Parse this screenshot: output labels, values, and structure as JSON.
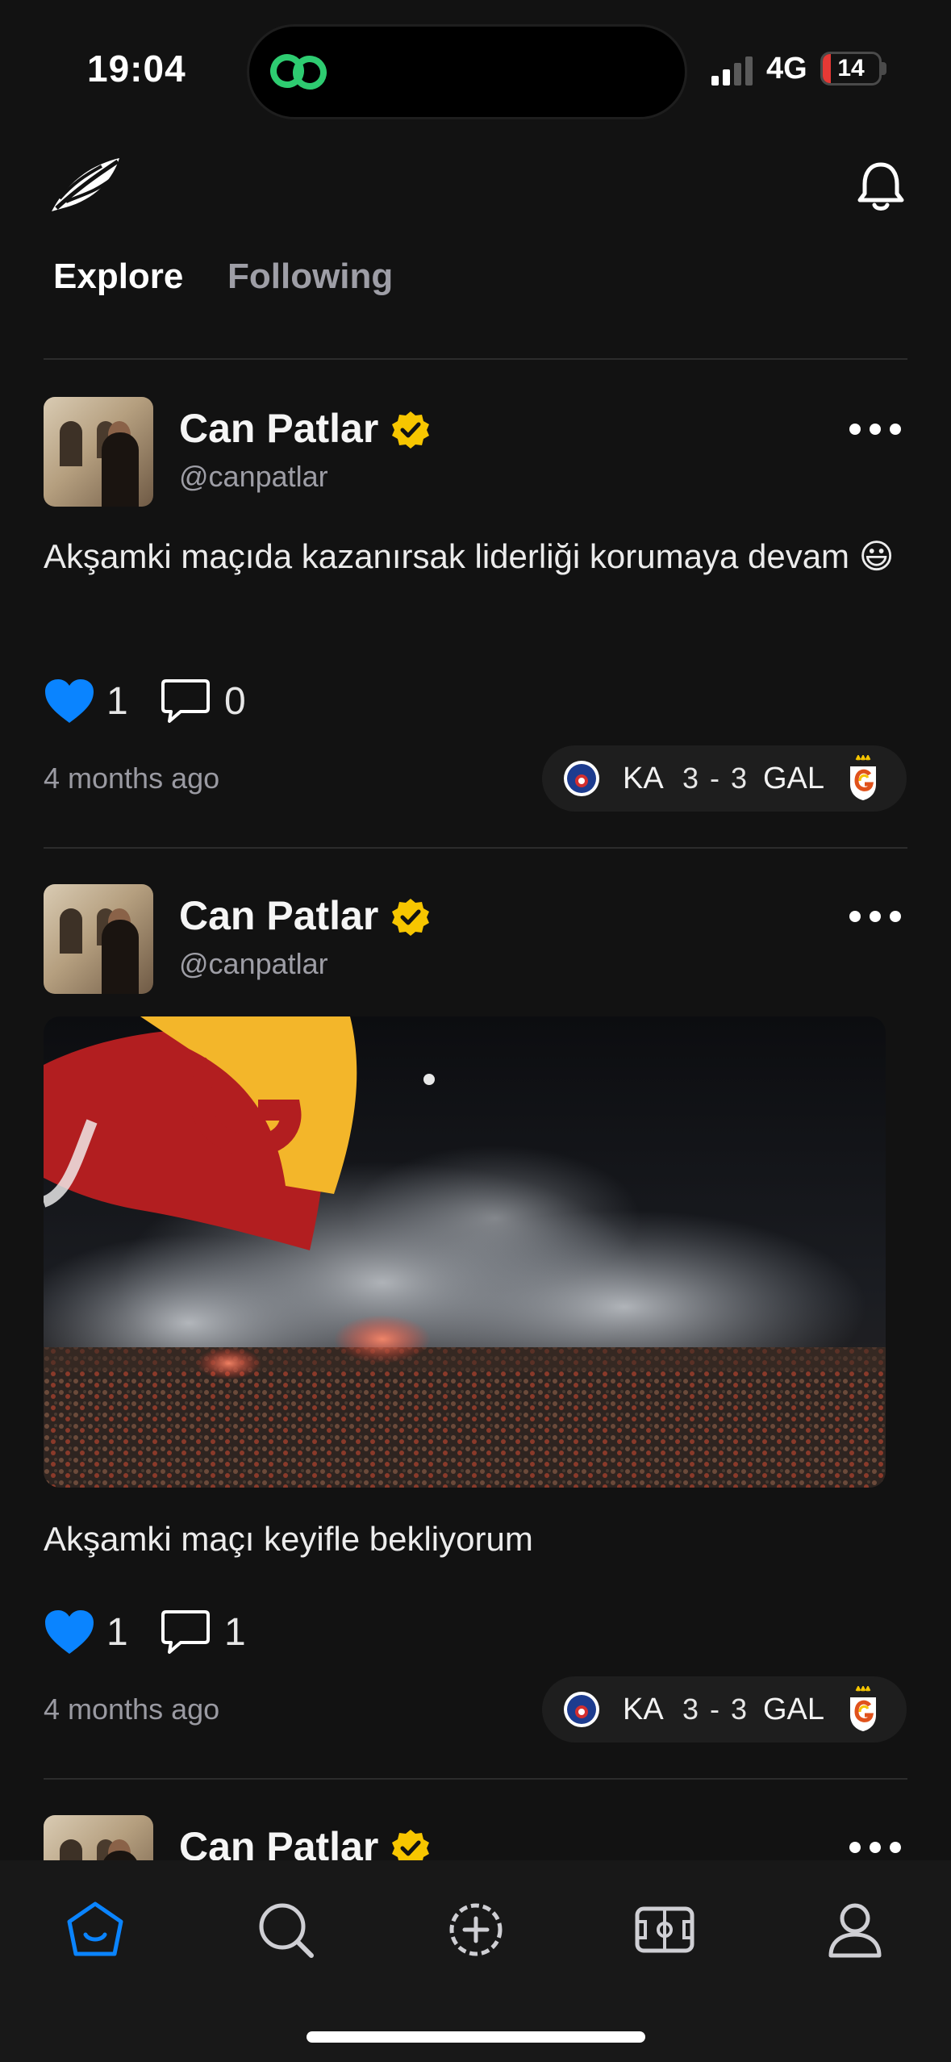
{
  "status_bar": {
    "time": "19:04",
    "network": "4G",
    "battery": "14",
    "battery_level": 0.14
  },
  "header": {
    "logo": "feather-logo-icon",
    "notifications": "bell-icon"
  },
  "tabs": [
    {
      "label": "Explore",
      "active": true
    },
    {
      "label": "Following",
      "active": false
    }
  ],
  "posts": [
    {
      "author": "Can Patlar",
      "handle": "@canpatlar",
      "verified": true,
      "text": "Akşamki maçıda kazanırsak liderliği korumaya devam 😃",
      "likes": "1",
      "comments": "0",
      "time": "4 months ago",
      "match": {
        "home": "KA",
        "score": "3 - 3",
        "away": "GAL"
      }
    },
    {
      "author": "Can Patlar",
      "handle": "@canpatlar",
      "verified": true,
      "has_image": true,
      "text": "Akşamki maçı keyifle bekliyorum",
      "likes": "1",
      "comments": "1",
      "time": "4 months ago",
      "match": {
        "home": "KA",
        "score": "3 - 3",
        "away": "GAL"
      }
    },
    {
      "author": "Can Patlar",
      "verified": true
    }
  ],
  "tab_bar": {
    "items": [
      "home-icon",
      "search-icon",
      "add-post-icon",
      "pitch-icon",
      "profile-icon"
    ],
    "active": "home-icon"
  },
  "colors": {
    "background": "#121212",
    "accent": "#0a84ff",
    "verified": "#f7c600",
    "battery_low": "#e53935"
  }
}
